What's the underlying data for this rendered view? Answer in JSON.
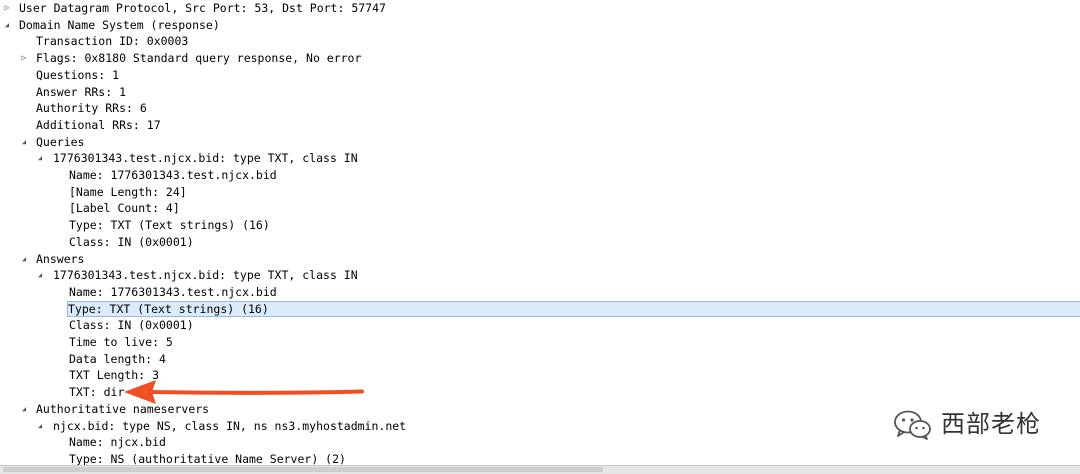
{
  "colors": {
    "selection_bg": "#dcebfc",
    "selection_border": "#8fbaea",
    "arrow": "#f04e23"
  },
  "icons": {
    "expanded": "triangle-down-icon",
    "collapsed": "triangle-right-icon"
  },
  "tree": [
    {
      "text": "User Datagram Protocol, Src Port: 53, Dst Port: 57747",
      "indent": 0,
      "toggle": "collapsed",
      "selected": false
    },
    {
      "text": "Domain Name System (response)",
      "indent": 0,
      "toggle": "expanded",
      "selected": false
    },
    {
      "text": "Transaction ID: 0x0003",
      "indent": 1,
      "toggle": "none",
      "selected": false
    },
    {
      "text": "Flags: 0x8180 Standard query response, No error",
      "indent": 1,
      "toggle": "collapsed",
      "selected": false
    },
    {
      "text": "Questions: 1",
      "indent": 1,
      "toggle": "none",
      "selected": false
    },
    {
      "text": "Answer RRs: 1",
      "indent": 1,
      "toggle": "none",
      "selected": false
    },
    {
      "text": "Authority RRs: 6",
      "indent": 1,
      "toggle": "none",
      "selected": false
    },
    {
      "text": "Additional RRs: 17",
      "indent": 1,
      "toggle": "none",
      "selected": false
    },
    {
      "text": "Queries",
      "indent": 1,
      "toggle": "expanded",
      "selected": false
    },
    {
      "text": "1776301343.test.njcx.bid: type TXT, class IN",
      "indent": 2,
      "toggle": "expanded",
      "selected": false
    },
    {
      "text": "Name: 1776301343.test.njcx.bid",
      "indent": 3,
      "toggle": "none",
      "selected": false
    },
    {
      "text": "[Name Length: 24]",
      "indent": 3,
      "toggle": "none",
      "selected": false
    },
    {
      "text": "[Label Count: 4]",
      "indent": 3,
      "toggle": "none",
      "selected": false
    },
    {
      "text": "Type: TXT (Text strings) (16)",
      "indent": 3,
      "toggle": "none",
      "selected": false
    },
    {
      "text": "Class: IN (0x0001)",
      "indent": 3,
      "toggle": "none",
      "selected": false
    },
    {
      "text": "Answers",
      "indent": 1,
      "toggle": "expanded",
      "selected": false
    },
    {
      "text": "1776301343.test.njcx.bid: type TXT, class IN",
      "indent": 2,
      "toggle": "expanded",
      "selected": false
    },
    {
      "text": "Name: 1776301343.test.njcx.bid",
      "indent": 3,
      "toggle": "none",
      "selected": false
    },
    {
      "text": "Type: TXT (Text strings) (16)",
      "indent": 3,
      "toggle": "none",
      "selected": true
    },
    {
      "text": "Class: IN (0x0001)",
      "indent": 3,
      "toggle": "none",
      "selected": false
    },
    {
      "text": "Time to live: 5",
      "indent": 3,
      "toggle": "none",
      "selected": false
    },
    {
      "text": "Data length: 4",
      "indent": 3,
      "toggle": "none",
      "selected": false
    },
    {
      "text": "TXT Length: 3",
      "indent": 3,
      "toggle": "none",
      "selected": false
    },
    {
      "text": "TXT: dir",
      "indent": 3,
      "toggle": "none",
      "selected": false
    },
    {
      "text": "Authoritative nameservers",
      "indent": 1,
      "toggle": "expanded",
      "selected": false
    },
    {
      "text": "njcx.bid: type NS, class IN, ns ns3.myhostadmin.net",
      "indent": 2,
      "toggle": "expanded",
      "selected": false
    },
    {
      "text": "Name: njcx.bid",
      "indent": 3,
      "toggle": "none",
      "selected": false
    },
    {
      "text": "Type: NS (authoritative Name Server) (2)",
      "indent": 3,
      "toggle": "none",
      "selected": false
    }
  ],
  "watermark": {
    "text": "西部老枪"
  }
}
